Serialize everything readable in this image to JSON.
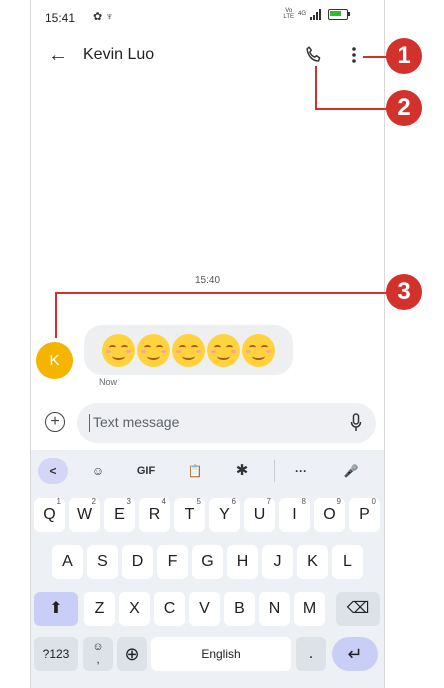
{
  "status": {
    "time": "15:41",
    "left_icons": "✿ ♆",
    "volte_top": "Vo",
    "volte_bottom": "LTE",
    "signal_label": "4G",
    "battery_level": 0.7
  },
  "header": {
    "contact_name": "Kevin Luo",
    "back_icon": "arrow-left-icon",
    "call_icon": "phone-icon",
    "more_icon": "more-vert-icon"
  },
  "conversation": {
    "divider_time": "15:40",
    "avatar_letter": "K",
    "avatar_color": "#f4b400",
    "message_emojis": [
      "smiling-face",
      "smiling-face",
      "smiling-face",
      "smiling-face",
      "smiling-face"
    ],
    "message_meta": "Now"
  },
  "compose": {
    "placeholder": "Text message",
    "add_icon": "plus-circle-icon",
    "mic_icon": "mic-icon"
  },
  "keyboard": {
    "toolbar": {
      "back": "<",
      "sticker": "☺",
      "gif": "GIF",
      "clipboard": "📋",
      "settings": "✱",
      "more": "···",
      "mic": "🎤"
    },
    "row1": [
      {
        "k": "Q",
        "s": "1"
      },
      {
        "k": "W",
        "s": "2"
      },
      {
        "k": "E",
        "s": "3"
      },
      {
        "k": "R",
        "s": "4"
      },
      {
        "k": "T",
        "s": "5"
      },
      {
        "k": "Y",
        "s": "6"
      },
      {
        "k": "U",
        "s": "7"
      },
      {
        "k": "I",
        "s": "8"
      },
      {
        "k": "O",
        "s": "9"
      },
      {
        "k": "P",
        "s": "0"
      }
    ],
    "row2": [
      "A",
      "S",
      "D",
      "F",
      "G",
      "H",
      "J",
      "K",
      "L"
    ],
    "row3": [
      "Z",
      "X",
      "C",
      "V",
      "B",
      "N",
      "M"
    ],
    "shift": "⬆",
    "backspace": "⌫",
    "symbols": "?123",
    "emoji_comma": "☺\n,",
    "globe": "⊕",
    "space": "English",
    "period": ".",
    "enter": "↵"
  },
  "callouts": [
    "1",
    "2",
    "3"
  ],
  "colors": {
    "accent": "#d3312b",
    "keyboard_bg": "#edf0f5",
    "bubble": "#eeeff1"
  }
}
